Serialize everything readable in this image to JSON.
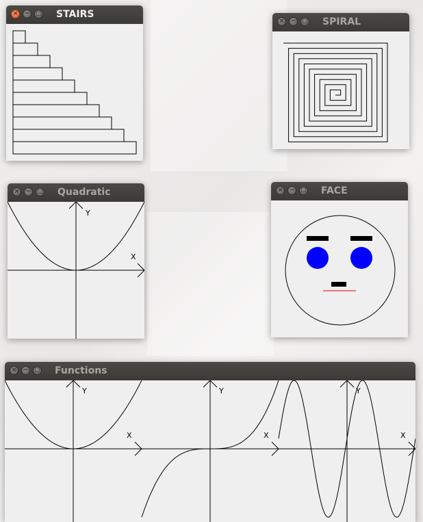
{
  "windows": {
    "stairs": {
      "title": "STAIRS",
      "active": true
    },
    "spiral": {
      "title": "SPIRAL",
      "active": false
    },
    "quadratic": {
      "title": "Quadratic",
      "active": false
    },
    "face": {
      "title": "FACE",
      "active": false
    },
    "functions": {
      "title": "Functions",
      "active": false
    }
  },
  "window_controls": {
    "close": "×",
    "minimize": "−",
    "maximize": "□"
  },
  "axis_labels": {
    "x": "X",
    "y": "Y"
  },
  "colors": {
    "cheeks": "#0000ff",
    "mouth": "#e00000",
    "features": "#000000"
  },
  "stairs": {
    "step_count": 10
  },
  "spiral": {
    "ring_count": 9
  },
  "functions_panels": [
    "quadratic",
    "cubic",
    "sine"
  ]
}
